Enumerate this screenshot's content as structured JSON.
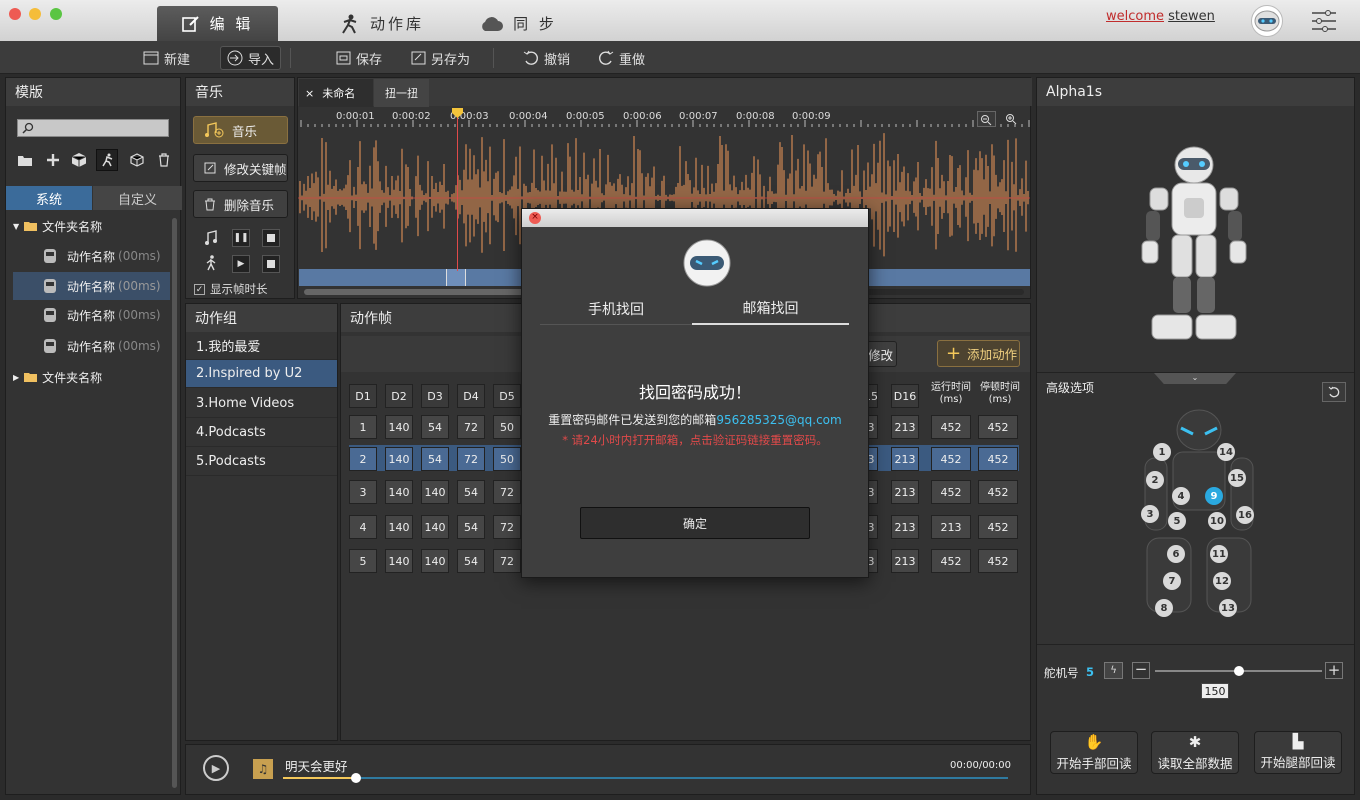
{
  "app": {
    "tabs": [
      {
        "label": "编 辑"
      },
      {
        "label": "动作库"
      },
      {
        "label": "同 步"
      }
    ],
    "welcome": "welcome",
    "user": "stewen"
  },
  "toolbar": {
    "new": "新建",
    "import": "导入",
    "save": "保存",
    "save_as": "另存为",
    "undo": "撤销",
    "redo": "重做"
  },
  "template": {
    "title": "模版",
    "tab_system": "系统",
    "tab_custom": "自定义",
    "folder1": "文件夹名称",
    "folder2": "文件夹名称",
    "items": [
      {
        "name": "动作名称",
        "dur": "(00ms)"
      },
      {
        "name": "动作名称",
        "dur": "(00ms)"
      },
      {
        "name": "动作名称",
        "dur": "(00ms)"
      },
      {
        "name": "动作名称",
        "dur": "(00ms)"
      }
    ]
  },
  "music": {
    "title": "音乐",
    "btn_music": "音乐",
    "btn_edit_keyframe": "修改关键帧",
    "btn_delete_music": "删除音乐",
    "show_duration": "显示帧时长"
  },
  "doc_tabs": {
    "tab1": "未命名",
    "tab2": "扭一扭",
    "close": "×"
  },
  "timeline": {
    "ticks": [
      "0:00:01",
      "0:00:02",
      "0:00:03",
      "0:00:04",
      "0:00:05",
      "0:00:06",
      "0:00:07",
      "0:00:08",
      "0:00:09"
    ]
  },
  "action_group": {
    "title": "动作组",
    "items": [
      "1.我的最爱",
      "2.Inspired by U2",
      "3.Home Videos",
      "4.Podcasts",
      "5.Podcasts"
    ]
  },
  "action_frame": {
    "title": "动作帧",
    "modify": "修改",
    "add": "添加动作",
    "headers_left": [
      "D1",
      "D2",
      "D3",
      "D4",
      "D5"
    ],
    "headers_right": [
      "15",
      "D16"
    ],
    "run_time": "运行时间",
    "stop_time": "停顿时间",
    "unit": "(ms)",
    "rows": [
      {
        "d": [
          "1",
          "140",
          "54",
          "72",
          "50"
        ],
        "r": [
          "3",
          "213"
        ],
        "run": "452",
        "stop": "452"
      },
      {
        "d": [
          "2",
          "140",
          "54",
          "72",
          "50"
        ],
        "r": [
          "3",
          "213"
        ],
        "run": "452",
        "stop": "452"
      },
      {
        "d": [
          "3",
          "140",
          "140",
          "54",
          "72"
        ],
        "r": [
          "3",
          "213"
        ],
        "run": "452",
        "stop": "452"
      },
      {
        "d": [
          "4",
          "140",
          "140",
          "54",
          "72"
        ],
        "r": [
          "3",
          "213"
        ],
        "run": "213",
        "stop": "452"
      },
      {
        "d": [
          "5",
          "140",
          "140",
          "54",
          "72"
        ],
        "r": [
          "3",
          "213"
        ],
        "run": "452",
        "stop": "452"
      }
    ]
  },
  "player": {
    "song": "明天会更好",
    "time": "00:00/00:00",
    "progress": 0.1
  },
  "robot": {
    "title": "Alpha1s",
    "advanced": "高级选项",
    "servo_label": "舵机号",
    "servo_no": "5",
    "servo_value": "150",
    "slider": 0.5,
    "joints": [
      "1",
      "2",
      "3",
      "4",
      "5",
      "6",
      "7",
      "8",
      "9",
      "10",
      "11",
      "12",
      "13",
      "14",
      "15",
      "16"
    ],
    "btn_hand": "开始手部回读",
    "btn_all": "读取全部数据",
    "btn_leg": "开始腿部回读"
  },
  "dialog": {
    "tab_phone": "手机找回",
    "tab_email": "邮箱找回",
    "heading": "找回密码成功！",
    "msg": "重置密码邮件已发送到您的邮箱",
    "email": "956285325@qq.com",
    "warn": "* 请24小时内打开邮箱，点击验证码链接重置密码。",
    "ok": "确定"
  }
}
